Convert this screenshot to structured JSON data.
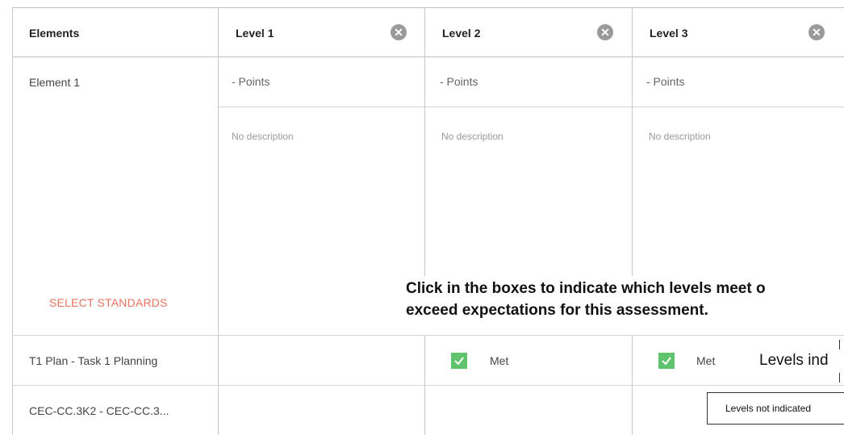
{
  "header": {
    "elements_label": "Elements",
    "levels": [
      {
        "label": "Level 1"
      },
      {
        "label": "Level 2"
      },
      {
        "label": "Level 3"
      }
    ],
    "close_glyph": "✕"
  },
  "rows": {
    "element1": {
      "label": "Element 1",
      "points": [
        "- Points",
        "- Points",
        "- Points"
      ],
      "descriptions": [
        "No description",
        "No description",
        "No description"
      ],
      "select_standards": "SELECT STANDARDS"
    },
    "standard1": {
      "label": "T1 Plan - Task 1 Planning",
      "checks": [
        {
          "level": "Level 2",
          "checked": true,
          "label": "Met"
        },
        {
          "level": "Level 3",
          "checked": true,
          "label": "Met"
        }
      ]
    },
    "standard2": {
      "label": "CEC-CC.3K2 - CEC-CC.3..."
    }
  },
  "annotations": {
    "callout_line1": "Click in the boxes to indicate which levels meet o",
    "callout_line2": "exceed expectations for this assessment.",
    "levels_indicated": "Levels ind",
    "levels_not_indicated": "Levels not indicated"
  },
  "colors": {
    "accent_link": "#e8735f",
    "check_green": "#5fc26d",
    "close_icon_bg": "#9a9a9a"
  }
}
